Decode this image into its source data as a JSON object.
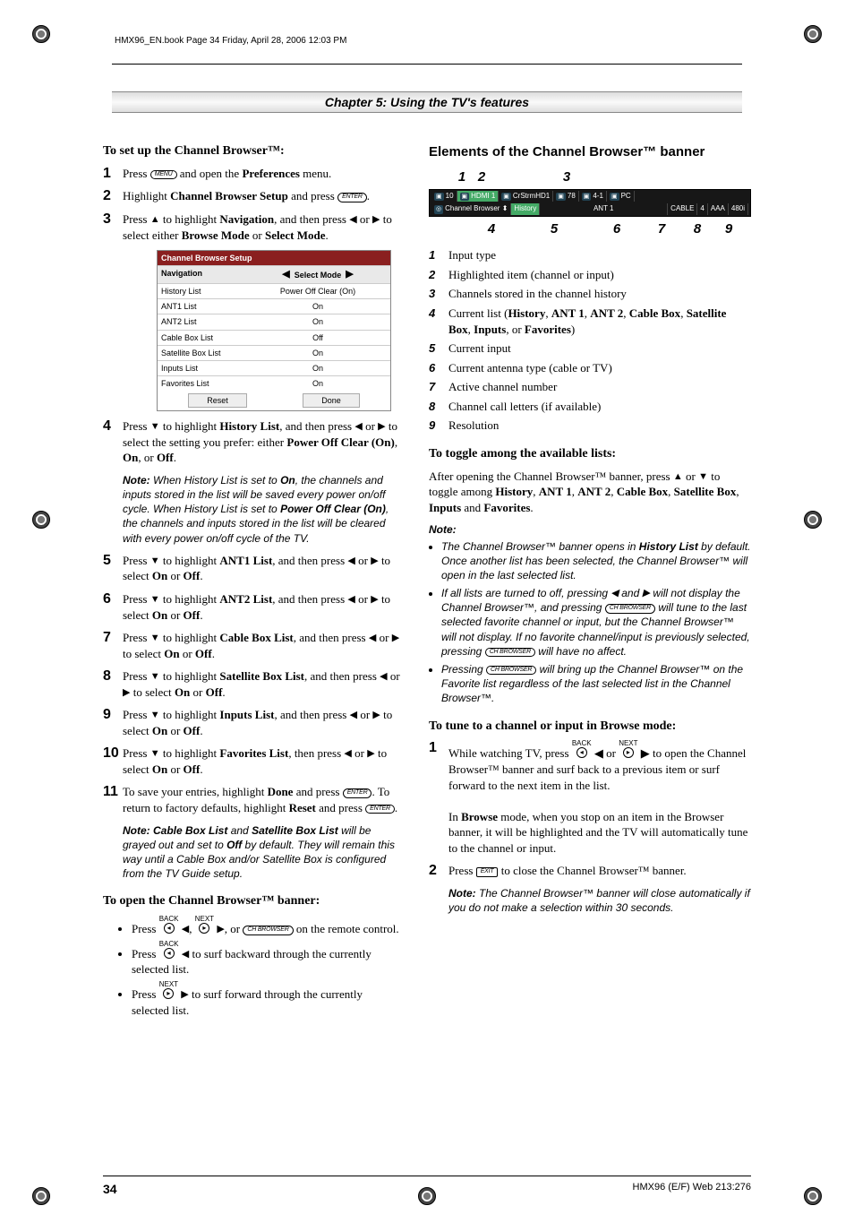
{
  "header_line": "HMX96_EN.book  Page 34  Friday, April 28, 2006  12:03 PM",
  "chapter_title": "Chapter 5: Using the TV's features",
  "page_number": "34",
  "doc_ref": "HMX96 (E/F) Web 213:276",
  "buttons": {
    "menu": "MENU",
    "enter": "ENTER",
    "exit": "EXIT",
    "chbrowser": "CH BROWSER"
  },
  "arrows": {
    "u": "▲",
    "d": "▼",
    "l": "◀",
    "r": "▶"
  },
  "left": {
    "h1": "To set up the Channel Browser™:",
    "steps": [
      {
        "pre": "Press ",
        "mid": " and open the ",
        "post": " menu.",
        "btn": "menu",
        "bold1": "Preferences"
      },
      {
        "pre": "Highlight ",
        "bold1": "Channel Browser Setup",
        "mid": " and press ",
        "btn": "enter",
        "post": "."
      },
      {
        "pre": "Press ",
        "arr1": "u",
        "mid1": " to highlight ",
        "bold1": "Navigation",
        "mid2": ", and then press ",
        "arr2": "l",
        "mid3": " or ",
        "arr3": "r",
        "post": " to select either ",
        "bold2": "Browse Mode",
        "mid4": " or ",
        "bold3": "Select Mode",
        "end": "."
      }
    ],
    "table": {
      "title": "Channel Browser Setup",
      "head": {
        "left": "Navigation",
        "right": "Select Mode"
      },
      "rows": [
        {
          "l": "History List",
          "r": "Power Off Clear (On)"
        },
        {
          "l": "ANT1 List",
          "r": "On"
        },
        {
          "l": "ANT2 List",
          "r": "On"
        },
        {
          "l": "Cable Box List",
          "r": "Off"
        },
        {
          "l": "Satellite Box List",
          "r": "On"
        },
        {
          "l": "Inputs List",
          "r": "On"
        },
        {
          "l": "Favorites List",
          "r": "On"
        }
      ],
      "footer": {
        "reset": "Reset",
        "done": "Done"
      }
    },
    "steps2": [
      {
        "n": "4",
        "pre": "Press ",
        "arr1": "d",
        "mid1": " to highlight ",
        "bold1": "History List",
        "mid2": ", and then press ",
        "arr2": "l",
        "mid3": " or ",
        "arr3": "r",
        "post": " to select the setting you prefer: either ",
        "bold2": "Power Off Clear (On)",
        "mid4": ", ",
        "bold3": "On",
        "mid5": ", or ",
        "bold4": "Off",
        "end": "."
      },
      {
        "n": "5",
        "pre": "Press ",
        "arr1": "d",
        "mid1": " to highlight ",
        "bold1": "ANT1 List",
        "mid2": ", and then press ",
        "arr2": "l",
        "mid3": " or ",
        "arr3": "r",
        "post": " to select ",
        "bold2": "On",
        "mid4": " or ",
        "bold3": "Off",
        "end": "."
      },
      {
        "n": "6",
        "pre": "Press ",
        "arr1": "d",
        "mid1": " to highlight ",
        "bold1": "ANT2 List",
        "mid2": ", and then press ",
        "arr2": "l",
        "mid3": " or ",
        "arr3": "r",
        "post": " to select ",
        "bold2": "On",
        "mid4": " or ",
        "bold3": "Off",
        "end": "."
      },
      {
        "n": "7",
        "pre": "Press ",
        "arr1": "d",
        "mid1": " to highlight ",
        "bold1": "Cable Box List",
        "mid2": ", and then press ",
        "arr2": "l",
        "mid3": " or ",
        "arr3": "r",
        "post": " to select ",
        "bold2": "On",
        "mid4": " or ",
        "bold3": "Off",
        "end": "."
      },
      {
        "n": "8",
        "pre": "Press ",
        "arr1": "d",
        "mid1": " to highlight ",
        "bold1": "Satellite Box List",
        "mid2": ", and then press ",
        "arr2": "l",
        "mid3": " or ",
        "arr3": "r",
        "post": " to select ",
        "bold2": "On",
        "mid4": " or ",
        "bold3": "Off",
        "end": "."
      },
      {
        "n": "9",
        "pre": "Press ",
        "arr1": "d",
        "mid1": " to highlight ",
        "bold1": "Inputs List",
        "mid2": ", and then press ",
        "arr2": "l",
        "mid3": " or ",
        "arr3": "r",
        "post": " to select ",
        "bold2": "On",
        "mid4": " or ",
        "bold3": "Off",
        "end": "."
      },
      {
        "n": "10",
        "pre": "Press ",
        "arr1": "d",
        "mid1": " to highlight ",
        "bold1": "Favorites List",
        "mid2": ", then press ",
        "arr2": "l",
        "mid3": " or ",
        "arr3": "r",
        "post": " to select ",
        "bold2": "On",
        "mid4": " or ",
        "bold3": "Off",
        "end": "."
      },
      {
        "n": "11",
        "text": "To save your entries, highlight ",
        "bold1": "Done",
        "mid": " and press ",
        "btn": "enter",
        "line2a": ". To return to factory defaults, highlight ",
        "bold2": "Reset",
        "line2b": " and press ",
        "btn2": "enter",
        "end": "."
      }
    ],
    "note1_head": "Note:",
    "note1": " When History List is set to ",
    "note1_b1": "On",
    "note1_mid": ", the channels and inputs stored in the list will be saved every power on/off cycle. When History List is set to ",
    "note1_b2": "Power Off Clear (On)",
    "note1_post": ", the channels and inputs stored in the list will be cleared with every power on/off cycle of the TV.",
    "note2_head": "Note: ",
    "note2_b1": "Cable Box List",
    "note2_mid1": " and ",
    "note2_b2": "Satellite Box List",
    "note2_mid2": " will be grayed out and set to ",
    "note2_b3": "Off",
    "note2_post": " by default. They will remain this way until a Cable Box and/or Satellite Box is configured from the TV Guide setup.",
    "h2": "To open the Channel Browser™ banner:",
    "open_bullets": [
      "Press ⓑ ◀, ⓑ ▶, or CH BROWSER on the remote control.",
      "Press ⓑ ◀ to surf backward through the currently selected list.",
      "Press ⓑ ▶ to surf forward through the currently selected list."
    ]
  },
  "right": {
    "h1": "Elements of the Channel Browser™ banner",
    "labels_top": [
      "1",
      "2",
      "3"
    ],
    "labels_bot": [
      "4",
      "5",
      "6",
      "7",
      "8",
      "9"
    ],
    "banner_top": [
      {
        "icon": "■",
        "txt": "10"
      },
      {
        "icon": "■",
        "txt": "HDMI 1"
      },
      {
        "icon": "■",
        "txt": "CrStrmHD1"
      },
      {
        "icon": "■",
        "txt": "78"
      },
      {
        "icon": "■",
        "txt": "4-1"
      },
      {
        "icon": "■",
        "txt": "PC"
      }
    ],
    "banner_bot": {
      "cb": "Channel Browser",
      "list": "History",
      "sep1": "ANT 1",
      "sep2": "CABLE",
      "ch": "4",
      "call": "AAA",
      "res": "480i"
    },
    "legend": [
      "Input type",
      "Highlighted item (channel or input)",
      "Channels stored in the channel history",
      "Current list (History, ANT 1, ANT 2, Cable Box, Satellite Box, Inputs, or Favorites)",
      "Current input",
      "Current antenna type (cable or TV)",
      "Active channel number",
      "Channel call letters (if available)",
      "Resolution"
    ],
    "legend4": {
      "pre": "Current list (",
      "items": [
        "History",
        "ANT 1",
        "ANT 2",
        "Cable Box",
        "Satellite Box",
        "Inputs",
        "Favorites"
      ],
      "post": ")"
    },
    "h2": "To toggle among the available lists:",
    "toggle_pre": "After opening the Channel Browser™ banner, press ",
    "toggle_mid": " or ",
    "toggle_post": " to toggle among ",
    "toggle_items": [
      "History",
      "ANT 1",
      "ANT 2",
      "Cable Box",
      "Satellite Box",
      "Inputs",
      "Favorites"
    ],
    "note_head": "Note:",
    "notes": [
      "The Channel Browser™ banner opens in History List by default. Once another list has been selected, the Channel Browser™ will open in the last selected list.",
      "If all lists are turned to off, pressing ◀ and ▶ will not display the Channel Browser™, and pressing CH BROWSER will tune to the last selected favorite channel or input, but the Channel Browser™  will not display.  If no favorite channel/input is previously selected, pressing CH BROWSER will have no affect.",
      "Pressing CH BROWSER will bring up the Channel Browser™ on the Favorite list regardless of the last selected list in the Channel Browser™."
    ],
    "note1_b1": "History List",
    "h3": "To tune to a channel or input in Browse mode:",
    "tune": [
      {
        "n": "1",
        "pre": "While watching TV, press ",
        "mid1": " ◀ or ",
        "mid2": " ▶ to open the Channel Browser™ banner and surf back to a previous item or surf forward to the next item in the list.",
        "line2": "In Browse mode, when you stop on an item in the Browser banner, it will be highlighted and the TV will automatically tune to the channel or input.",
        "line2_b": "Browse"
      },
      {
        "n": "2",
        "pre": "Press ",
        "btn": "exit",
        "post": " to close the Channel Browser™ banner."
      }
    ],
    "tune_note_head": "Note:",
    "tune_note": " The Channel Browser™ banner will close automatically if you do not make a selection within 30 seconds."
  }
}
